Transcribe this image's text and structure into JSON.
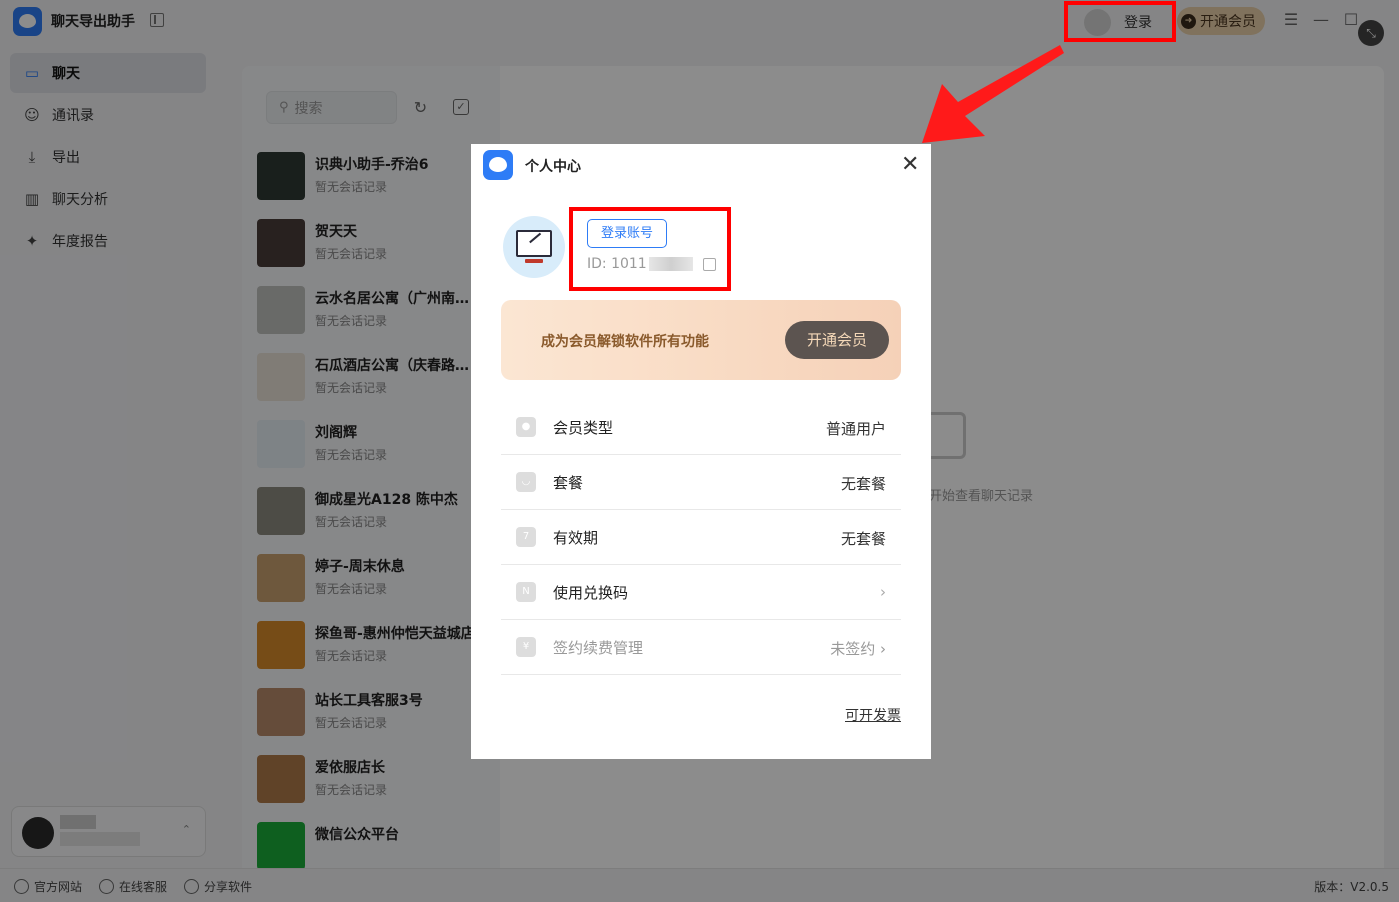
{
  "app": {
    "title": "聊天导出助手",
    "login_label": "登录",
    "vip_label": "开通会员",
    "version": "版本：V2.0.5"
  },
  "sidebar": {
    "items": [
      {
        "label": "聊天",
        "icon": "chat-icon",
        "active": true
      },
      {
        "label": "通讯录",
        "icon": "contacts-icon",
        "active": false
      },
      {
        "label": "导出",
        "icon": "download-icon",
        "active": false
      },
      {
        "label": "聊天分析",
        "icon": "bar-chart-icon",
        "active": false
      },
      {
        "label": "年度报告",
        "icon": "sparkle-icon",
        "active": false
      }
    ]
  },
  "search": {
    "placeholder": "搜索"
  },
  "chats": [
    {
      "name": "识典小助手-乔治6",
      "sub": "暂无会话记录",
      "color": "#2f3a34"
    },
    {
      "name": "贺天天",
      "sub": "暂无会话记录",
      "color": "#4a3d3a"
    },
    {
      "name": "云水名居公寓（广州南站店）",
      "sub": "暂无会话记录",
      "color": "#bfc2bd"
    },
    {
      "name": "石瓜酒店公寓（庆春路店）",
      "sub": "暂无会话记录",
      "color": "#e9e2d8"
    },
    {
      "name": "刘阁辉",
      "sub": "暂无会话记录",
      "color": "#e6eef5"
    },
    {
      "name": "御成星光A128 陈中杰",
      "sub": "暂无会话记录",
      "color": "#8d8a80"
    },
    {
      "name": "婷子-周末休息",
      "sub": "暂无会话记录",
      "color": "#c9a070"
    },
    {
      "name": "探鱼哥-惠州仲恺天益城店",
      "sub": "暂无会话记录",
      "color": "#d88a2a"
    },
    {
      "name": "站长工具客服3号",
      "sub": "暂无会话记录",
      "color": "#b88a6a"
    },
    {
      "name": "爱依服店长",
      "sub": "暂无会话记录",
      "color": "#b07a4a"
    },
    {
      "name": "微信公众平台",
      "sub": "",
      "color": "#1aad3a"
    }
  ],
  "empty_hint": "开始查看聊天记录",
  "bottom": {
    "website": "官方网站",
    "support": "在线客服",
    "share": "分享软件"
  },
  "modal": {
    "title": "个人中心",
    "close": "✕",
    "login_button": "登录账号",
    "id_prefix": "ID: 1011",
    "vip_banner_text": "成为会员解锁软件所有功能",
    "vip_banner_button": "开通会员",
    "rows": [
      {
        "label": "会员类型",
        "value": "普通用户",
        "icon": "user-icon",
        "muted": false
      },
      {
        "label": "套餐",
        "value": "无套餐",
        "icon": "bag-icon",
        "muted": false
      },
      {
        "label": "有效期",
        "value": "无套餐",
        "icon": "calendar-icon",
        "muted": false
      },
      {
        "label": "使用兑换码",
        "value": "›",
        "icon": "coupon-icon",
        "muted": false
      },
      {
        "label": "签约续费管理",
        "value": "未签约 ›",
        "icon": "yen-icon",
        "muted": true
      }
    ],
    "invoice_link": "可开发票"
  }
}
